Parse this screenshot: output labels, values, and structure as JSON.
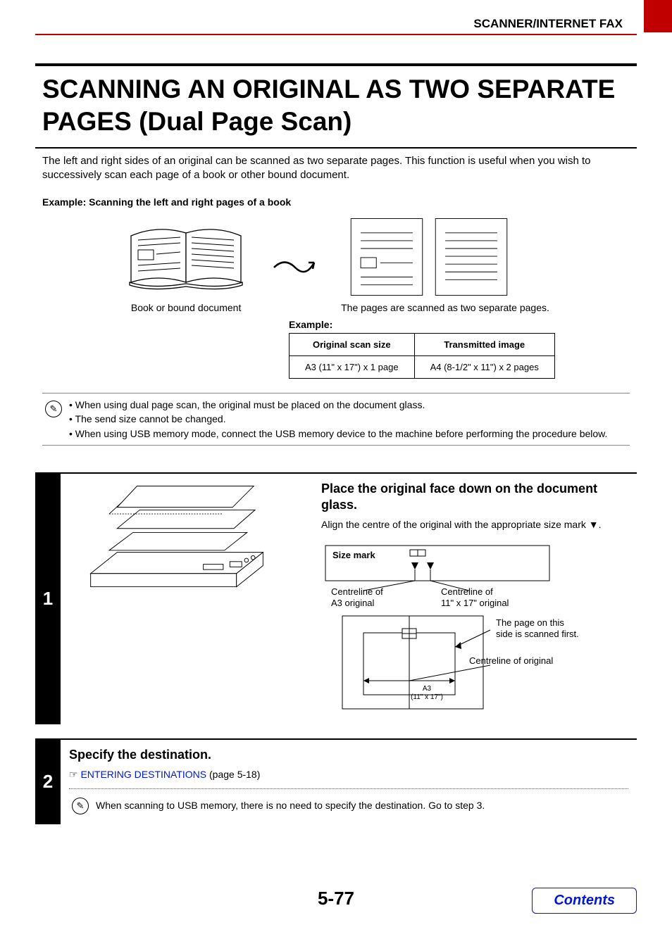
{
  "header": {
    "section": "SCANNER/INTERNET FAX"
  },
  "title": "SCANNING AN ORIGINAL AS TWO SEPARATE PAGES (Dual Page Scan)",
  "intro": "The left and right sides of an original can be scanned as two separate pages. This function is useful when you wish to successively scan each page of a book or other bound document.",
  "example": {
    "heading": "Example: Scanning the left and right pages of a book",
    "book_caption": "Book or bound document",
    "pages_caption": "The pages are scanned as two separate pages.",
    "table_label": "Example:",
    "table": {
      "headers": [
        "Original scan size",
        "Transmitted image"
      ],
      "rows": [
        [
          "A3 (11\" x 17\") x 1 page",
          "A4 (8-1/2\" x 11\") x 2 pages"
        ]
      ]
    }
  },
  "notes": [
    "When using dual page scan, the original must be placed on the document glass.",
    "The send size cannot be changed.",
    "When using USB memory mode, connect the USB memory device to the machine before performing the procedure below."
  ],
  "steps": [
    {
      "number": "1",
      "heading": "Place the original face down on the document glass.",
      "text_before": "Align the centre of the original with the appropriate size mark",
      "text_after": ".",
      "diagram": {
        "size_mark": "Size mark",
        "centre_a3_l1": "Centreline of",
        "centre_a3_l2": "A3 original",
        "centre_11_l1": "Centreline of",
        "centre_11_l2": "11\" x 17\" original",
        "first_scan_l1": "The page on this",
        "first_scan_l2": "side is scanned first.",
        "centre_orig": "Centreline of original",
        "a3": "A3",
        "a3_dim": "(11\" x 17\")"
      }
    },
    {
      "number": "2",
      "heading": "Specify the destination.",
      "link_text": "ENTERING DESTINATIONS",
      "link_suffix": " (page 5-18)",
      "note": "When scanning to USB memory, there is no need to specify the destination. Go to step 3."
    }
  ],
  "footer": {
    "page": "5-77",
    "contents_label": "Contents"
  }
}
